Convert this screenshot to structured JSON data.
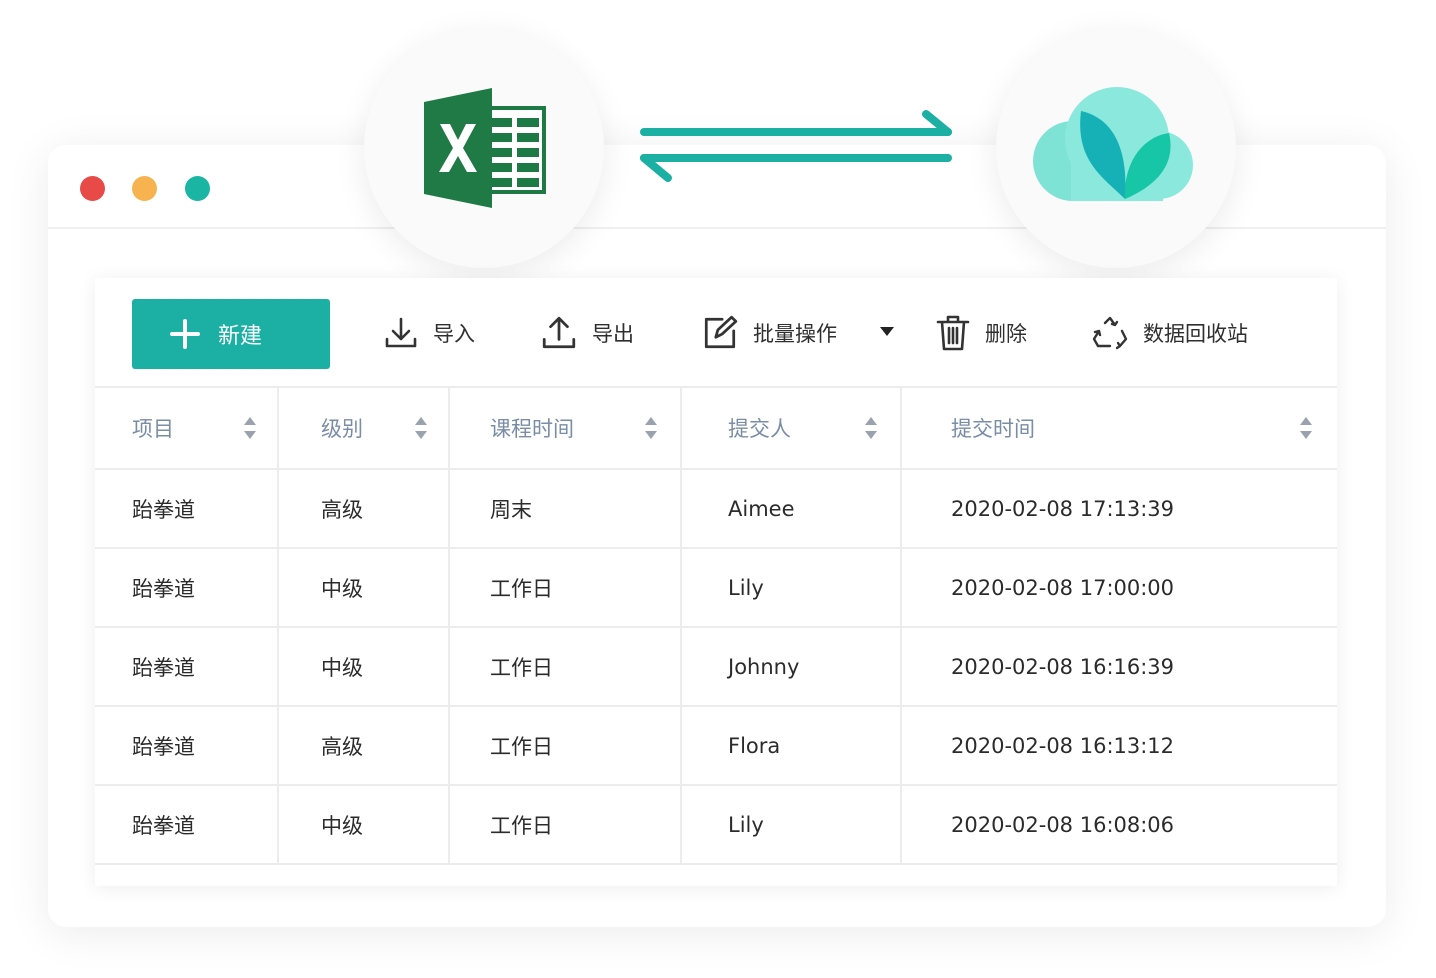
{
  "colors": {
    "accent": "#1bb0a3",
    "red": "#e84a47",
    "yellow": "#f7b34f",
    "green": "#1bb5a4",
    "excel": "#1d7a44",
    "header_text": "#7a8da6"
  },
  "badges": {
    "left_icon": "excel-icon",
    "right_icon": "cloud-heart-logo-icon",
    "between_icon": "sync-arrows-icon"
  },
  "toolbar": {
    "new_label": "新建",
    "import_label": "导入",
    "export_label": "导出",
    "batch_label": "批量操作",
    "delete_label": "删除",
    "recycle_label": "数据回收站"
  },
  "table": {
    "columns": [
      "项目",
      "级别",
      "课程时间",
      "提交人",
      "提交时间"
    ],
    "rows": [
      [
        "跆拳道",
        "高级",
        "周末",
        "Aimee",
        "2020-02-08 17:13:39"
      ],
      [
        "跆拳道",
        "中级",
        "工作日",
        "Lily",
        "2020-02-08 17:00:00"
      ],
      [
        "跆拳道",
        "中级",
        "工作日",
        "Johnny",
        "2020-02-08 16:16:39"
      ],
      [
        "跆拳道",
        "高级",
        "工作日",
        "Flora",
        "2020-02-08 16:13:12"
      ],
      [
        "跆拳道",
        "中级",
        "工作日",
        "Lily",
        "2020-02-08 16:08:06"
      ]
    ]
  }
}
